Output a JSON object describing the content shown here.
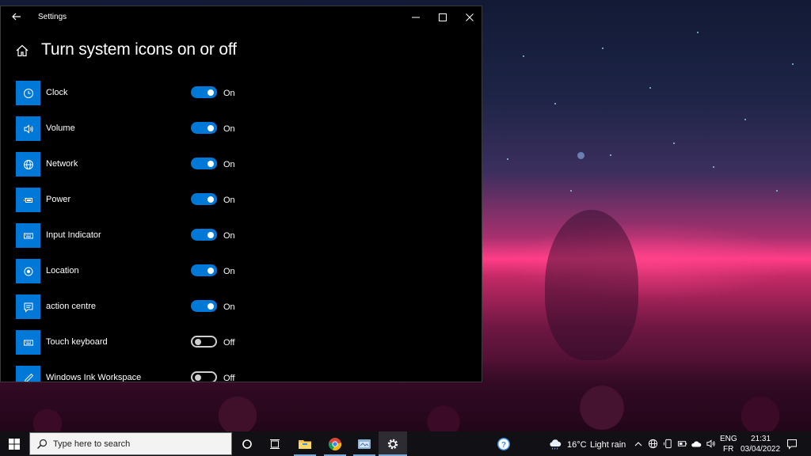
{
  "window": {
    "app_title": "Settings",
    "page_title": "Turn system icons on or off"
  },
  "settings": [
    {
      "label": "Clock",
      "state": "On",
      "on": true,
      "icon": "clock-icon"
    },
    {
      "label": "Volume",
      "state": "On",
      "on": true,
      "icon": "volume-icon"
    },
    {
      "label": "Network",
      "state": "On",
      "on": true,
      "icon": "globe-icon"
    },
    {
      "label": "Power",
      "state": "On",
      "on": true,
      "icon": "battery-icon"
    },
    {
      "label": "Input Indicator",
      "state": "On",
      "on": true,
      "icon": "keyboard-icon"
    },
    {
      "label": "Location",
      "state": "On",
      "on": true,
      "icon": "location-icon"
    },
    {
      "label": "action centre",
      "state": "On",
      "on": true,
      "icon": "action-centre-icon"
    },
    {
      "label": "Touch keyboard",
      "state": "Off",
      "on": false,
      "icon": "keyboard-icon"
    },
    {
      "label": "Windows Ink Workspace",
      "state": "Off",
      "on": false,
      "icon": "pen-icon"
    }
  ],
  "taskbar": {
    "search_placeholder": "Type here to search",
    "weather_temp": "16°C",
    "weather_text": "Light rain",
    "language_line1": "ENG",
    "language_line2": "FR",
    "time": "21:31",
    "date": "03/04/2022"
  },
  "colors": {
    "accent": "#0078d7",
    "window_bg": "#000000",
    "taskbar_bg": "#101015"
  }
}
